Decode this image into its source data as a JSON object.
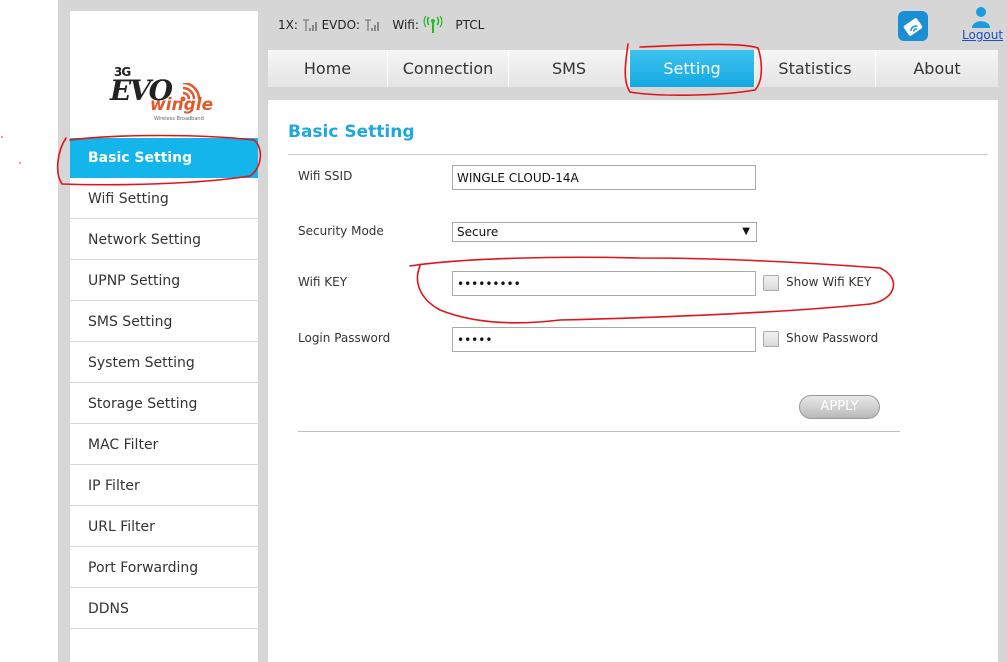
{
  "brand": {
    "line1": "3G",
    "line2": "EVO",
    "line3": "wingle",
    "tagline": "Wireless Broadband"
  },
  "status": {
    "onex_label": "1X:",
    "evdo_label": "EVDO:",
    "wifi_label": "Wifi:",
    "operator": "PTCL"
  },
  "header": {
    "logout_label": "Logout",
    "app_icon": "wifi-card-icon",
    "user_icon": "user-icon"
  },
  "nav": {
    "tabs": [
      {
        "label": "Home"
      },
      {
        "label": "Connection"
      },
      {
        "label": "SMS"
      },
      {
        "label": "Setting"
      },
      {
        "label": "Statistics"
      },
      {
        "label": "About"
      }
    ],
    "active": "Setting"
  },
  "sidebar": {
    "items": [
      {
        "label": "Basic Setting"
      },
      {
        "label": "Wifi Setting"
      },
      {
        "label": "Network Setting"
      },
      {
        "label": "UPNP Setting"
      },
      {
        "label": "SMS Setting"
      },
      {
        "label": "System Setting"
      },
      {
        "label": "Storage Setting"
      },
      {
        "label": "MAC Filter"
      },
      {
        "label": "IP Filter"
      },
      {
        "label": "URL Filter"
      },
      {
        "label": "Port Forwarding"
      },
      {
        "label": "DDNS"
      }
    ],
    "active": "Basic Setting"
  },
  "form": {
    "title": "Basic Setting",
    "ssid_label": "Wifi SSID",
    "ssid_value": "WINGLE CLOUD-14A",
    "security_label": "Security Mode",
    "security_value": "Secure",
    "key_label": "Wifi KEY",
    "key_value": "•••••••••",
    "show_key_label": "Show Wifi KEY",
    "password_label": "Login Password",
    "password_value": "•••••",
    "show_password_label": "Show Password",
    "apply_label": "APPLY"
  },
  "colors": {
    "accent": "#13b5ea",
    "title": "#1fa8de",
    "annotation": "#e0151a",
    "signal_green": "#22bb22"
  }
}
